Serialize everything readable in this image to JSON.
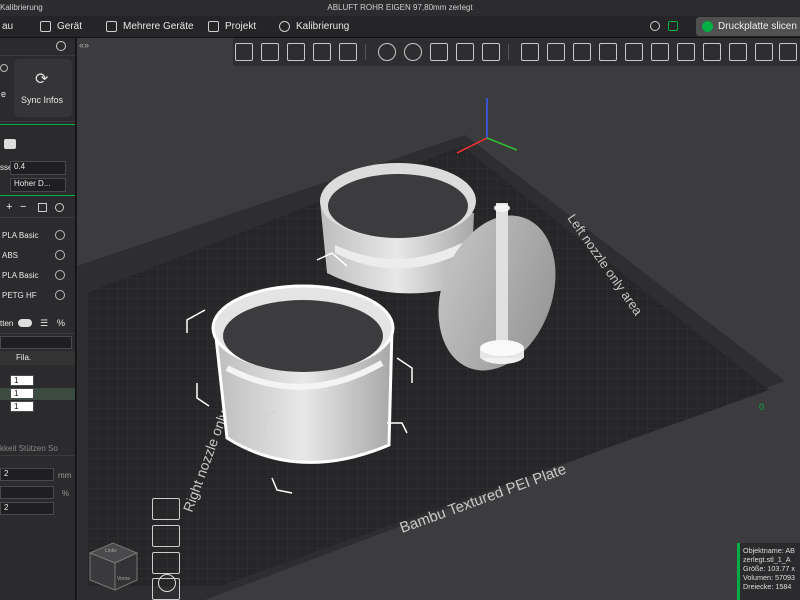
{
  "titlebar": {
    "left": "Kalibrierung",
    "center": "ABLUFT ROHR EIGEN 97,80mm zerlegt"
  },
  "menubar": {
    "items": [
      {
        "label": "au"
      },
      {
        "label": "Gerät"
      },
      {
        "label": "Mehrere Geräte"
      },
      {
        "label": "Projekt"
      },
      {
        "label": "Kalibrierung"
      }
    ],
    "slice_button": "Druckplatte slicen"
  },
  "leftpanel": {
    "sync_label": "Sync Infos",
    "edge_letter": "e",
    "nozzle_label": "sse",
    "nozzle_value": "0.4",
    "flow_value": "Hoher D...",
    "add_symbol": "+",
    "remove_symbol": "−",
    "filaments": [
      {
        "name": "PLA Basic",
        "color": "#e8e8e8"
      },
      {
        "name": "ABS",
        "color": "#dddddd"
      },
      {
        "name": "PLA Basic",
        "color": "#d0d0d0"
      },
      {
        "name": "PETG HF",
        "color": "#c8c8c8"
      }
    ],
    "objects_label": "tten",
    "col_header": "Fila.",
    "object_rows": [
      {
        "value": "1"
      },
      {
        "value": "1"
      },
      {
        "value": "1"
      }
    ],
    "tabs_label": "kkeit  Stützen  So",
    "param1_value": "2",
    "param1_unit": "mm",
    "param2_unit": "%",
    "param3_value": "2"
  },
  "viewport": {
    "plate_label": "Bambu Textured PEI Plate",
    "left_nozzle_label": "Right nozzle only area",
    "right_nozzle_label": "Left nozzle only area",
    "corner_index": "0"
  },
  "infobox": {
    "lines": [
      "Objektname: AB",
      "zerlegt.stl_1_A",
      "Größe: 103.77 x",
      "Volumen: 57093",
      "Dreiecke: 1584"
    ]
  },
  "viewcube": {
    "front": "Vorne",
    "back": "Links"
  },
  "colors": {
    "accent": "#00ae42",
    "panel": "#2b2b2d",
    "plate": "#2a2a2a",
    "viewport": "#3c3c3e"
  }
}
